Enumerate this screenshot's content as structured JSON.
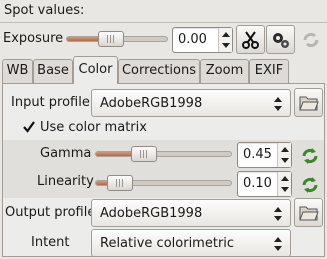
{
  "header": {
    "spot_values_label": "Spot values:"
  },
  "exposure": {
    "label": "Exposure",
    "value": "0.00",
    "slider_fraction": 0.42,
    "icons": [
      "scissors-icon",
      "gears-icon",
      "refresh-icon"
    ]
  },
  "tabs": [
    {
      "label": "WB",
      "active": false
    },
    {
      "label": "Base",
      "active": false
    },
    {
      "label": "Color",
      "active": true
    },
    {
      "label": "Corrections",
      "active": false
    },
    {
      "label": "Zoom",
      "active": false
    },
    {
      "label": "EXIF",
      "active": false
    }
  ],
  "color_panel": {
    "input_profile": {
      "label": "Input profile",
      "value": "AdobeRGB1998"
    },
    "use_color_matrix": {
      "label": "Use color matrix",
      "checked": true
    },
    "gamma": {
      "label": "Gamma",
      "value": "0.45",
      "slider_fraction": 0.32
    },
    "linearity": {
      "label": "Linearity",
      "value": "0.10",
      "slider_fraction": 0.1
    },
    "output_profile": {
      "label": "Output profile",
      "value": "AdobeRGB1998"
    },
    "intent": {
      "label": "Intent",
      "value": "Relative colorimetric"
    }
  },
  "colors": {
    "slider_fill": "#b36a45",
    "background": "#e9e7e3",
    "refresh_green": "#3b8a2a"
  }
}
